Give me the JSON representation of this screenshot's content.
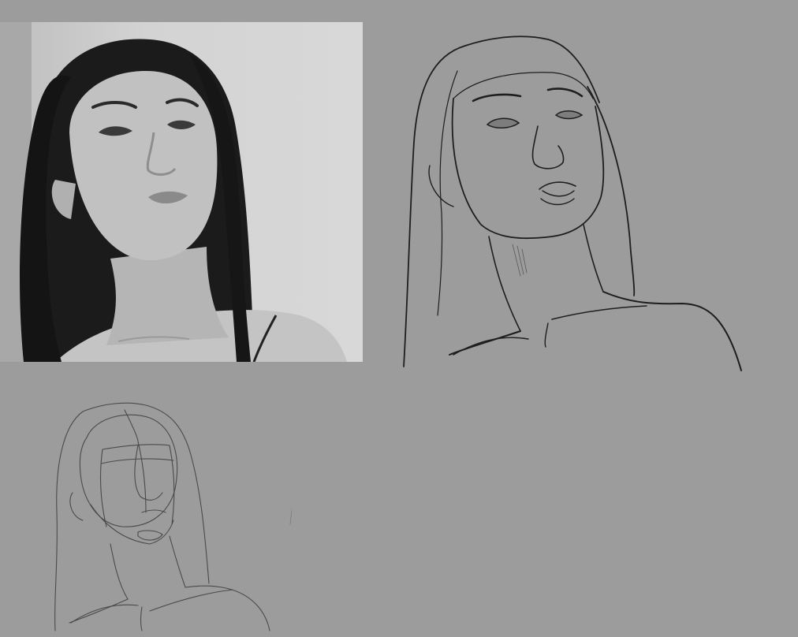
{
  "canvas": {
    "background": "#9c9c9c"
  },
  "panels": [
    {
      "name": "reference-photo",
      "kind": "grayscale portrait photograph"
    },
    {
      "name": "line-art-sketch",
      "kind": "ink line drawing"
    },
    {
      "name": "construction-sketch",
      "kind": "pencil construction drawing"
    }
  ],
  "colors": {
    "photo_background": "#d6d6d6",
    "hair": "#1a1a1a",
    "skin": "#b9b9b9",
    "ink": "#1e1e1e",
    "pencil": "#4a4a4a"
  }
}
